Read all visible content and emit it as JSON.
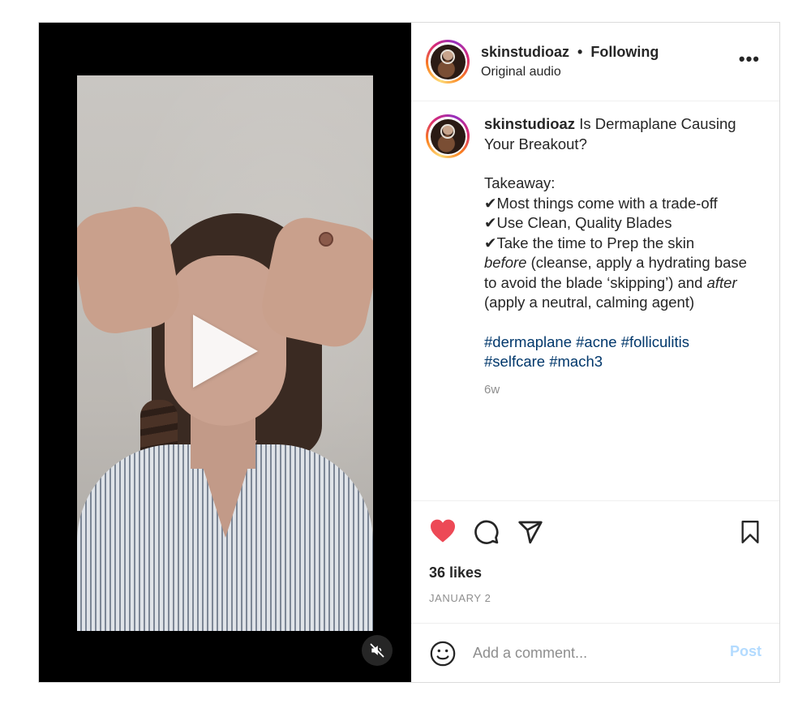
{
  "post": {
    "username": "skinstudioaz",
    "separator": "•",
    "follow_status": "Following",
    "audio": "Original audio",
    "more_label": "•••"
  },
  "caption": {
    "username": "skinstudioaz",
    "title": "Is Dermaplane Causing Your Breakout?",
    "takeaway_heading": "Takeaway:",
    "items": [
      "✔Most things come with a trade-off",
      "✔Use Clean, Quality Blades",
      "✔Take the time to Prep the skin"
    ],
    "before_word": "before",
    "before_text": " (cleanse, apply a hydrating base to avoid the blade ‘skipping’) and ",
    "after_word": "after",
    "after_text": " (apply a neutral, calming agent)",
    "hashtags": [
      "#dermaplane",
      "#acne",
      "#folliculitis",
      "#selfcare",
      "#mach3"
    ],
    "age": "6w"
  },
  "actions": {
    "liked": true,
    "like_color": "#ed4956",
    "likes": "36 likes",
    "date": "JANUARY 2"
  },
  "comment": {
    "placeholder": "Add a comment...",
    "post_label": "Post",
    "post_color": "#b3dbff"
  },
  "icons": {
    "play": "play-icon",
    "mute": "muted-speaker-icon",
    "heart": "heart-icon",
    "comment": "comment-icon",
    "share": "paper-plane-icon",
    "save": "bookmark-icon",
    "emoji": "smiley-icon",
    "more": "more-options-icon"
  }
}
